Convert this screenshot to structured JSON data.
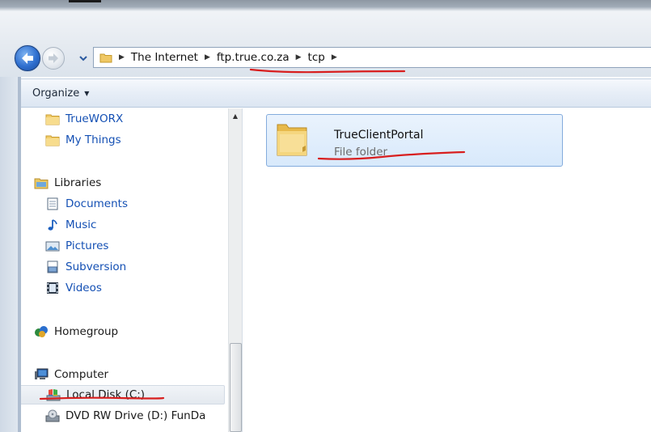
{
  "breadcrumb": {
    "items": [
      "The Internet",
      "ftp.true.co.za",
      "tcp"
    ]
  },
  "toolbar": {
    "organize_label": "Organize"
  },
  "nav": {
    "favorites": [
      {
        "label": "TrueWORX",
        "icon": "folder-icon"
      },
      {
        "label": "My Things",
        "icon": "folder-icon"
      }
    ],
    "libraries": {
      "label": "Libraries",
      "icon": "libraries-icon",
      "items": [
        {
          "label": "Documents",
          "icon": "document-library-icon"
        },
        {
          "label": "Music",
          "icon": "music-icon"
        },
        {
          "label": "Pictures",
          "icon": "pictures-icon"
        },
        {
          "label": "Subversion",
          "icon": "subversion-icon"
        },
        {
          "label": "Videos",
          "icon": "videos-icon"
        }
      ]
    },
    "homegroup": {
      "label": "Homegroup",
      "icon": "homegroup-icon"
    },
    "computer": {
      "label": "Computer",
      "icon": "computer-icon",
      "items": [
        {
          "label": "Local Disk (C:)",
          "icon": "local-disk-icon"
        },
        {
          "label": "DVD RW Drive (D:) FunDa",
          "icon": "dvd-drive-icon"
        }
      ]
    }
  },
  "content": {
    "items": [
      {
        "name": "TrueClientPortal",
        "type": "File folder",
        "icon": "folder-icon"
      }
    ]
  },
  "colors": {
    "accent": "#1450b4",
    "selection_fill": "#d8e9fb",
    "selection_border": "#84acdd",
    "annotation": "#d81e1e"
  }
}
